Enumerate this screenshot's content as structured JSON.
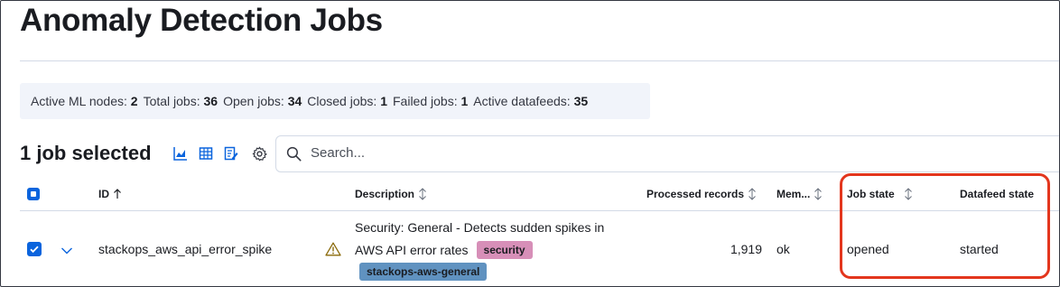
{
  "page": {
    "title": "Anomaly Detection Jobs"
  },
  "stats": [
    {
      "label": "Active ML nodes:",
      "value": "2"
    },
    {
      "label": "Total jobs:",
      "value": "36"
    },
    {
      "label": "Open jobs:",
      "value": "34"
    },
    {
      "label": "Closed jobs:",
      "value": "1"
    },
    {
      "label": "Failed jobs:",
      "value": "1"
    },
    {
      "label": "Active datafeeds:",
      "value": "35"
    }
  ],
  "selection": {
    "label": "1 job selected"
  },
  "toolbar": {
    "icons": [
      "chart-icon",
      "table-icon",
      "edit-document-icon",
      "gear-icon"
    ]
  },
  "search": {
    "placeholder": "Search...",
    "value": ""
  },
  "table": {
    "headers": {
      "id": "ID",
      "description": "Description",
      "processed_records": "Processed records",
      "memory": "Mem...",
      "job_state": "Job state",
      "datafeed_state": "Datafeed state"
    },
    "rows": [
      {
        "selected": true,
        "id": "stackops_aws_api_error_spike",
        "warning_icon": "warning-icon",
        "description_line1": "Security: General - Detects sudden spikes in",
        "description_line2": "AWS API error rates",
        "badges": [
          "security",
          "stackops-aws-general"
        ],
        "processed_records": "1,919",
        "memory": "ok",
        "job_state": "opened",
        "datafeed_state": "started"
      }
    ]
  },
  "colors": {
    "accent": "#0b64dd",
    "highlight": "#e3361d",
    "badge_security": "#d78fb8",
    "badge_group": "#6092c0"
  }
}
